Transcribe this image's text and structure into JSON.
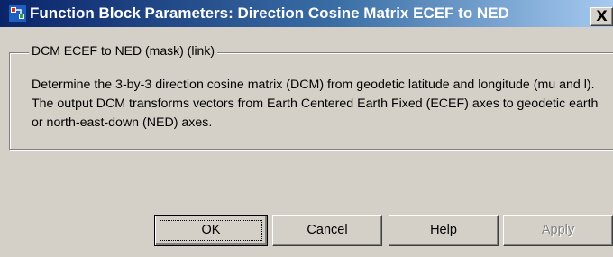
{
  "window": {
    "title": "Function Block Parameters: Direction Cosine Matrix ECEF to NED",
    "close_label": "X"
  },
  "group": {
    "legend": "DCM ECEF to NED (mask) (link)",
    "description": "Determine the 3-by-3 direction cosine matrix (DCM) from geodetic latitude and longitude (mu and l). The output DCM transforms vectors from Earth Centered Earth Fixed (ECEF) axes to geodetic earth or north-east-down (NED) axes."
  },
  "buttons": {
    "ok": "OK",
    "cancel": "Cancel",
    "help": "Help",
    "apply": "Apply"
  },
  "icons": {
    "app": "simulink-block-icon"
  },
  "colors": {
    "titlebar_start": "#0a246a",
    "titlebar_end": "#a6caf0",
    "dialog_bg": "#d4d0c8"
  }
}
